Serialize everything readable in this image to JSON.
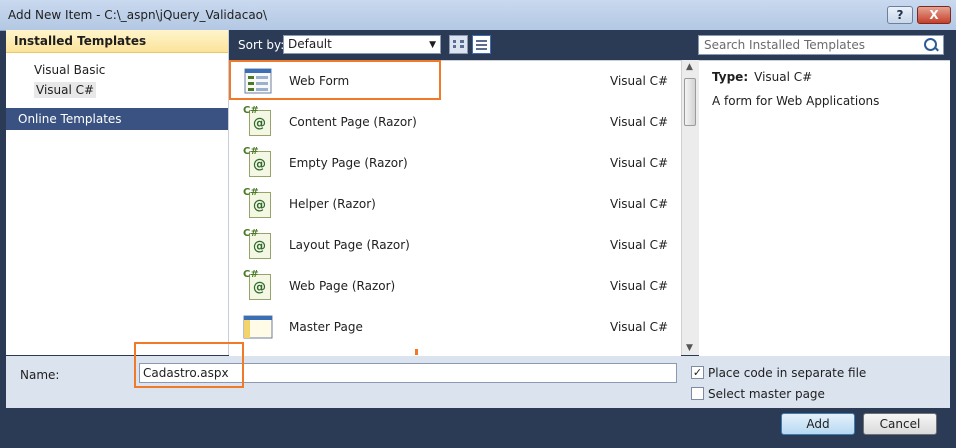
{
  "window": {
    "title": "Add New Item - C:\\_aspn\\jQuery_Validacao\\",
    "help_label": "?",
    "close_label": "X"
  },
  "left_pane": {
    "installed_header": "Installed Templates",
    "items": [
      "Visual Basic",
      "Visual C#"
    ],
    "online_header": "Online Templates"
  },
  "toolbar": {
    "sort_label": "Sort by:",
    "sort_value": "Default",
    "search_placeholder": "Search Installed Templates"
  },
  "templates": [
    {
      "name": "Web Form",
      "lang": "Visual C#",
      "icon": "webform-icon"
    },
    {
      "name": "Content Page (Razor)",
      "lang": "Visual C#",
      "icon": "razor-page-icon"
    },
    {
      "name": "Empty Page (Razor)",
      "lang": "Visual C#",
      "icon": "razor-page-icon"
    },
    {
      "name": "Helper (Razor)",
      "lang": "Visual C#",
      "icon": "razor-page-icon"
    },
    {
      "name": "Layout Page (Razor)",
      "lang": "Visual C#",
      "icon": "razor-page-icon"
    },
    {
      "name": "Web Page (Razor)",
      "lang": "Visual C#",
      "icon": "razor-page-icon"
    },
    {
      "name": "Master Page",
      "lang": "Visual C#",
      "icon": "master-page-icon"
    }
  ],
  "details": {
    "type_label": "Type:",
    "type_value": "Visual C#",
    "description": "A form for Web Applications"
  },
  "name_bar": {
    "label": "Name:",
    "value": "Cadastro.aspx",
    "place_code_label": "Place code in separate file",
    "place_code_checked": true,
    "master_page_label": "Select master page",
    "master_page_checked": false
  },
  "buttons": {
    "add": "Add",
    "cancel": "Cancel"
  },
  "colors": {
    "highlight": "#f07a2a",
    "online_header": "#3a5281",
    "dialog_frame": "#2b3a55"
  }
}
